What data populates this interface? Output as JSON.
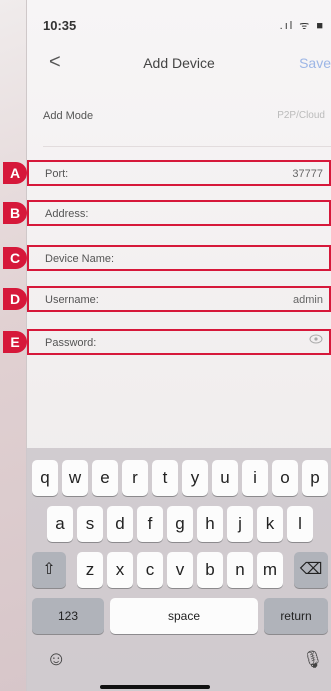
{
  "status_bar": {
    "time": "10:35",
    "icons": ".ıl ᯤ ■"
  },
  "nav": {
    "back_symbol": "<",
    "title": "Add Device",
    "save_label": "Save"
  },
  "add_mode": {
    "label": "Add Mode",
    "value": "P2P/Cloud"
  },
  "fields": [
    {
      "badge": "A",
      "label": "Port:",
      "value": "37777"
    },
    {
      "badge": "B",
      "label": "Address:",
      "value": ""
    },
    {
      "badge": "C",
      "label": "Device Name:",
      "value": ""
    },
    {
      "badge": "D",
      "label": "Username:",
      "value": "admin"
    },
    {
      "badge": "E",
      "label": "Password:",
      "value": ""
    }
  ],
  "keyboard": {
    "row1": [
      "q",
      "w",
      "e",
      "r",
      "t",
      "y",
      "u",
      "i",
      "o",
      "p"
    ],
    "row2": [
      "a",
      "s",
      "d",
      "f",
      "g",
      "h",
      "j",
      "k",
      "l"
    ],
    "row3": [
      "z",
      "x",
      "c",
      "v",
      "b",
      "n",
      "m"
    ],
    "shift": "⇧",
    "delete": "⌫",
    "numbers": "123",
    "space": "space",
    "return": "return",
    "emoji": "☺",
    "mic": "🎙"
  },
  "colors": {
    "highlight": "#d6183a",
    "save": "#9db6e6"
  }
}
